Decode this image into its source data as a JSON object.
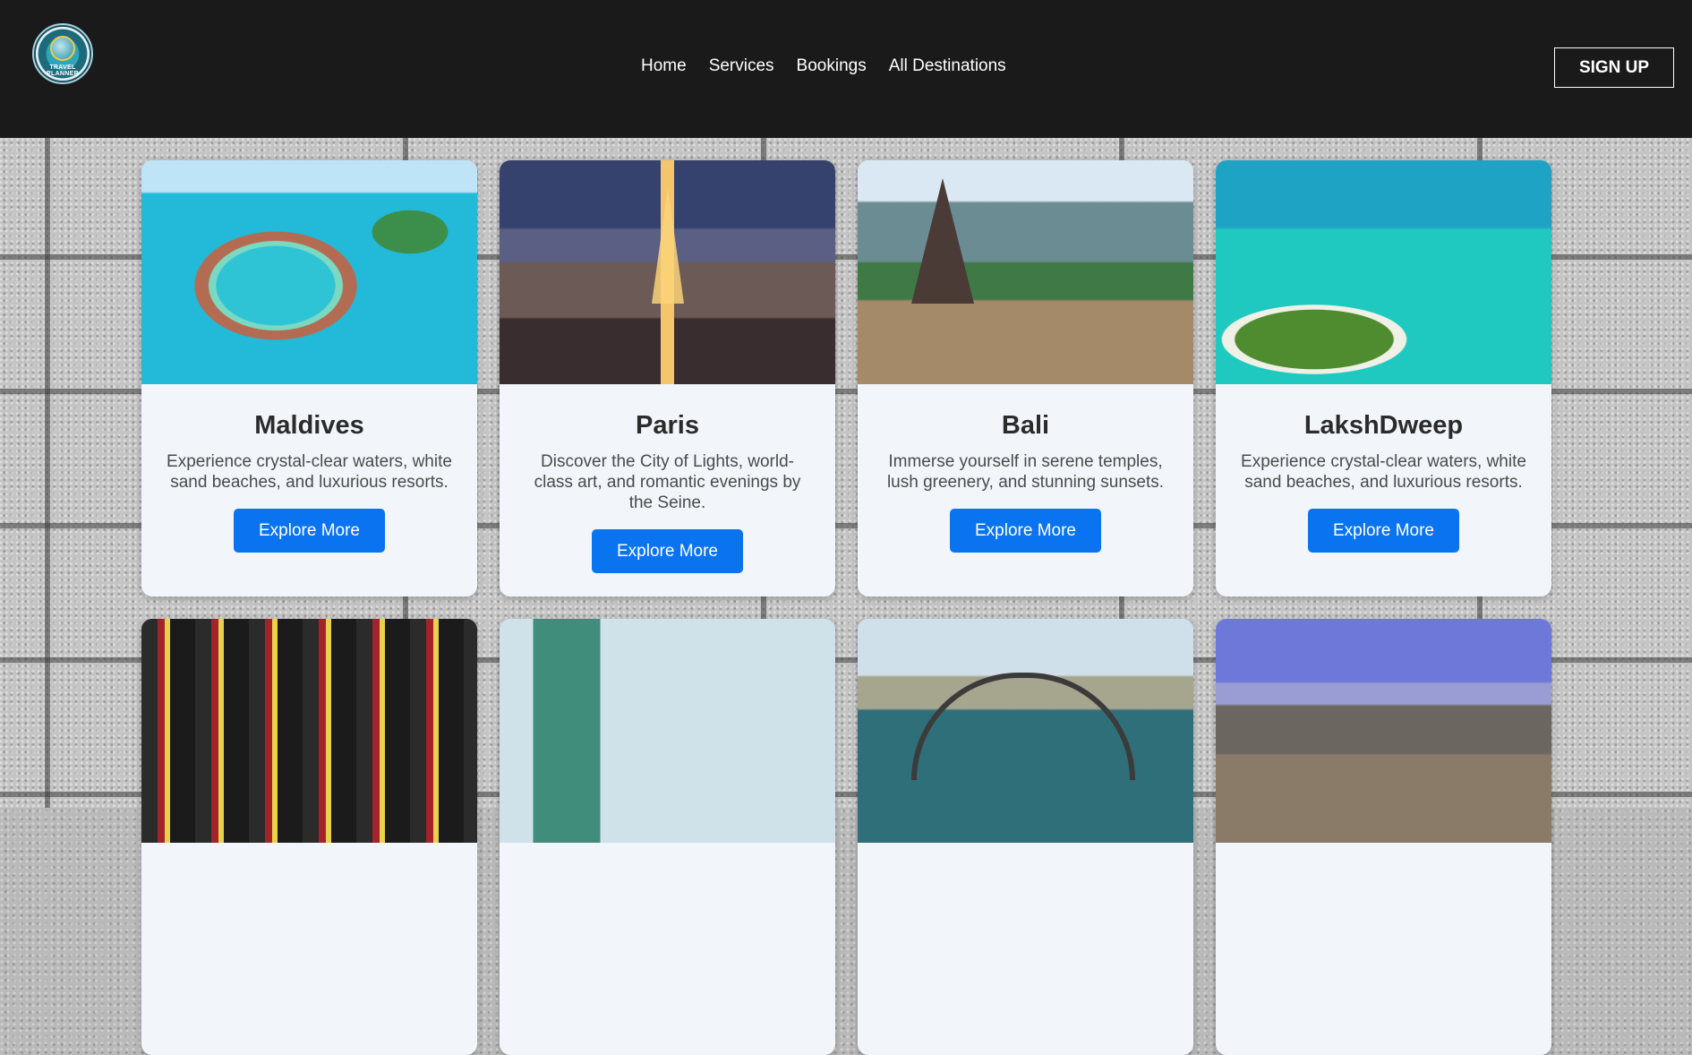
{
  "header": {
    "logo_text": "TRAVEL PLANNER",
    "nav": [
      "Home",
      "Services",
      "Bookings",
      "All Destinations"
    ],
    "signup_label": "SIGN UP"
  },
  "destinations": [
    {
      "title": "Maldives",
      "description": "Experience crystal-clear waters, white sand beaches, and luxurious resorts.",
      "button": "Explore More"
    },
    {
      "title": "Paris",
      "description": "Discover the City of Lights, world-class art, and romantic evenings by the Seine.",
      "button": "Explore More"
    },
    {
      "title": "Bali",
      "description": "Immerse yourself in serene temples, lush greenery, and stunning sunsets.",
      "button": "Explore More"
    },
    {
      "title": "LakshDweep",
      "description": "Experience crystal-clear waters, white sand beaches, and luxurious resorts.",
      "button": "Explore More"
    }
  ],
  "colors": {
    "header_bg": "#1a1a1a",
    "button_bg": "#0a74f0",
    "card_bg": "#f2f6fb"
  }
}
